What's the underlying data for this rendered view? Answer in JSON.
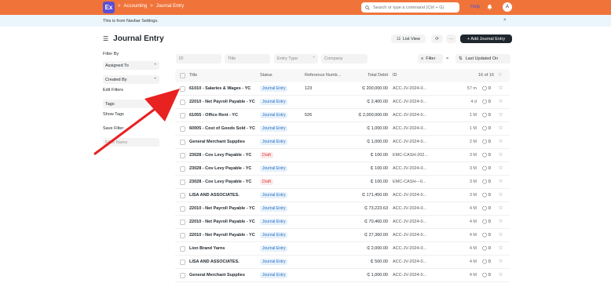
{
  "navbar": {
    "logo": "Ex",
    "crumb1": "Accounting",
    "crumb2": "Journal Entry",
    "sep": ">",
    "search_placeholder": "Search or type a command (Ctrl + G)",
    "help": "Help",
    "avatar": "A"
  },
  "banner": {
    "text": "This is from Navbar Settings.",
    "close": "×"
  },
  "page": {
    "title": "Journal Entry",
    "list_view": "List View",
    "more": "···",
    "add_button": "+ Add Journal Entry"
  },
  "sidebar": {
    "filter_by": "Filter By",
    "assigned_to": "Assigned To",
    "created_by": "Created By",
    "edit_filters": "Edit Filters",
    "tags": "Tags",
    "show_tags": "Show Tags",
    "save_filter": "Save Filter",
    "filter_name": "Filter Name"
  },
  "filters": {
    "id": "ID",
    "title": "Title",
    "entry_type": "Entry Type",
    "company": "Company",
    "filter": "Filter",
    "clear": "×",
    "sort": "Last Updated On"
  },
  "columns": {
    "title": "Title",
    "status": "Status",
    "reference": "Reference Numb...",
    "debit": "Total Debit",
    "id": "ID",
    "count": "16 of 16"
  },
  "rows": [
    {
      "title": "61010 - Salaries & Wages - YC",
      "status": "Journal Entry",
      "kind": "je",
      "ref": "123",
      "debit": "₵ 200,000.00",
      "id": "ACC-JV-2024-0...",
      "time": "57 m",
      "comments": "0"
    },
    {
      "title": "22010 - Net Payroll Payable - YC",
      "status": "Journal Entry",
      "kind": "je",
      "ref": "",
      "debit": "₵ 2,400.00",
      "id": "ACC-JV-2024-0...",
      "time": "4 d",
      "comments": "0"
    },
    {
      "title": "61055 - Office Rent - YC",
      "status": "Journal Entry",
      "kind": "je",
      "ref": "526",
      "debit": "₵ 2,000,000.00",
      "id": "ACC-JV-2024-0...",
      "time": "1 M",
      "comments": "0"
    },
    {
      "title": "60005 - Cost of Goods Sold - YC",
      "status": "Journal Entry",
      "kind": "je",
      "ref": "",
      "debit": "₵ 1,000.00",
      "id": "ACC-JV-2024-0...",
      "time": "1 M",
      "comments": "0"
    },
    {
      "title": "General Merchant Supplies",
      "status": "Journal Entry",
      "kind": "je",
      "ref": "",
      "debit": "₵ 1,000.00",
      "id": "ACC-JV-2024-0...",
      "time": "2 M",
      "comments": "0"
    },
    {
      "title": "23028 - Cov Levy Payable - YC",
      "status": "Draft",
      "kind": "draft",
      "ref": "",
      "debit": "₵ 100.00",
      "id": "EMC-CASH-202...",
      "time": "3 M",
      "comments": "0"
    },
    {
      "title": "23028 - Cov Levy Payable - YC",
      "status": "Journal Entry",
      "kind": "je",
      "ref": "",
      "debit": "₵ 100.00",
      "id": "ACC-JV-2024-0...",
      "time": "3 M",
      "comments": "0"
    },
    {
      "title": "23028 - Cov Levy Payable - YC",
      "status": "Draft",
      "kind": "draft",
      "ref": "",
      "debit": "₵ 100.00",
      "id": "EMC-CASH---0...",
      "time": "3 M",
      "comments": "0"
    },
    {
      "title": "LISA AND ASSOCIATES.",
      "status": "Journal Entry",
      "kind": "je",
      "ref": "",
      "debit": "₵ 171,450.00",
      "id": "ACC-JV-2024-0...",
      "time": "3 M",
      "comments": "0"
    },
    {
      "title": "22010 - Net Payroll Payable - YC",
      "status": "Journal Entry",
      "kind": "je",
      "ref": "",
      "debit": "₵ 73,223.63",
      "id": "ACC-JV-2024-0...",
      "time": "4 M",
      "comments": "0"
    },
    {
      "title": "22010 - Net Payroll Payable - YC",
      "status": "Journal Entry",
      "kind": "je",
      "ref": "",
      "debit": "₵ 70,460.00",
      "id": "ACC-JV-2024-0...",
      "time": "4 M",
      "comments": "0"
    },
    {
      "title": "22010 - Net Payroll Payable - YC",
      "status": "Journal Entry",
      "kind": "je",
      "ref": "",
      "debit": "₵ 27,360.00",
      "id": "ACC-JV-2024-0...",
      "time": "4 M",
      "comments": "0"
    },
    {
      "title": "Lion Brand Yarns",
      "status": "Journal Entry",
      "kind": "je",
      "ref": "",
      "debit": "₵ 2,000.00",
      "id": "ACC-JV-2024-0...",
      "time": "4 M",
      "comments": "0"
    },
    {
      "title": "LISA AND ASSOCIATES.",
      "status": "Journal Entry",
      "kind": "je",
      "ref": "",
      "debit": "₵ 500.00",
      "id": "ACC-JV-2024-0...",
      "time": "4 M",
      "comments": "0"
    },
    {
      "title": "General Merchant Supplies",
      "status": "Journal Entry",
      "kind": "je",
      "ref": "",
      "debit": "₵ 1,000.00",
      "id": "ACC-JV-2024-0...",
      "time": "4 M",
      "comments": "0"
    }
  ]
}
